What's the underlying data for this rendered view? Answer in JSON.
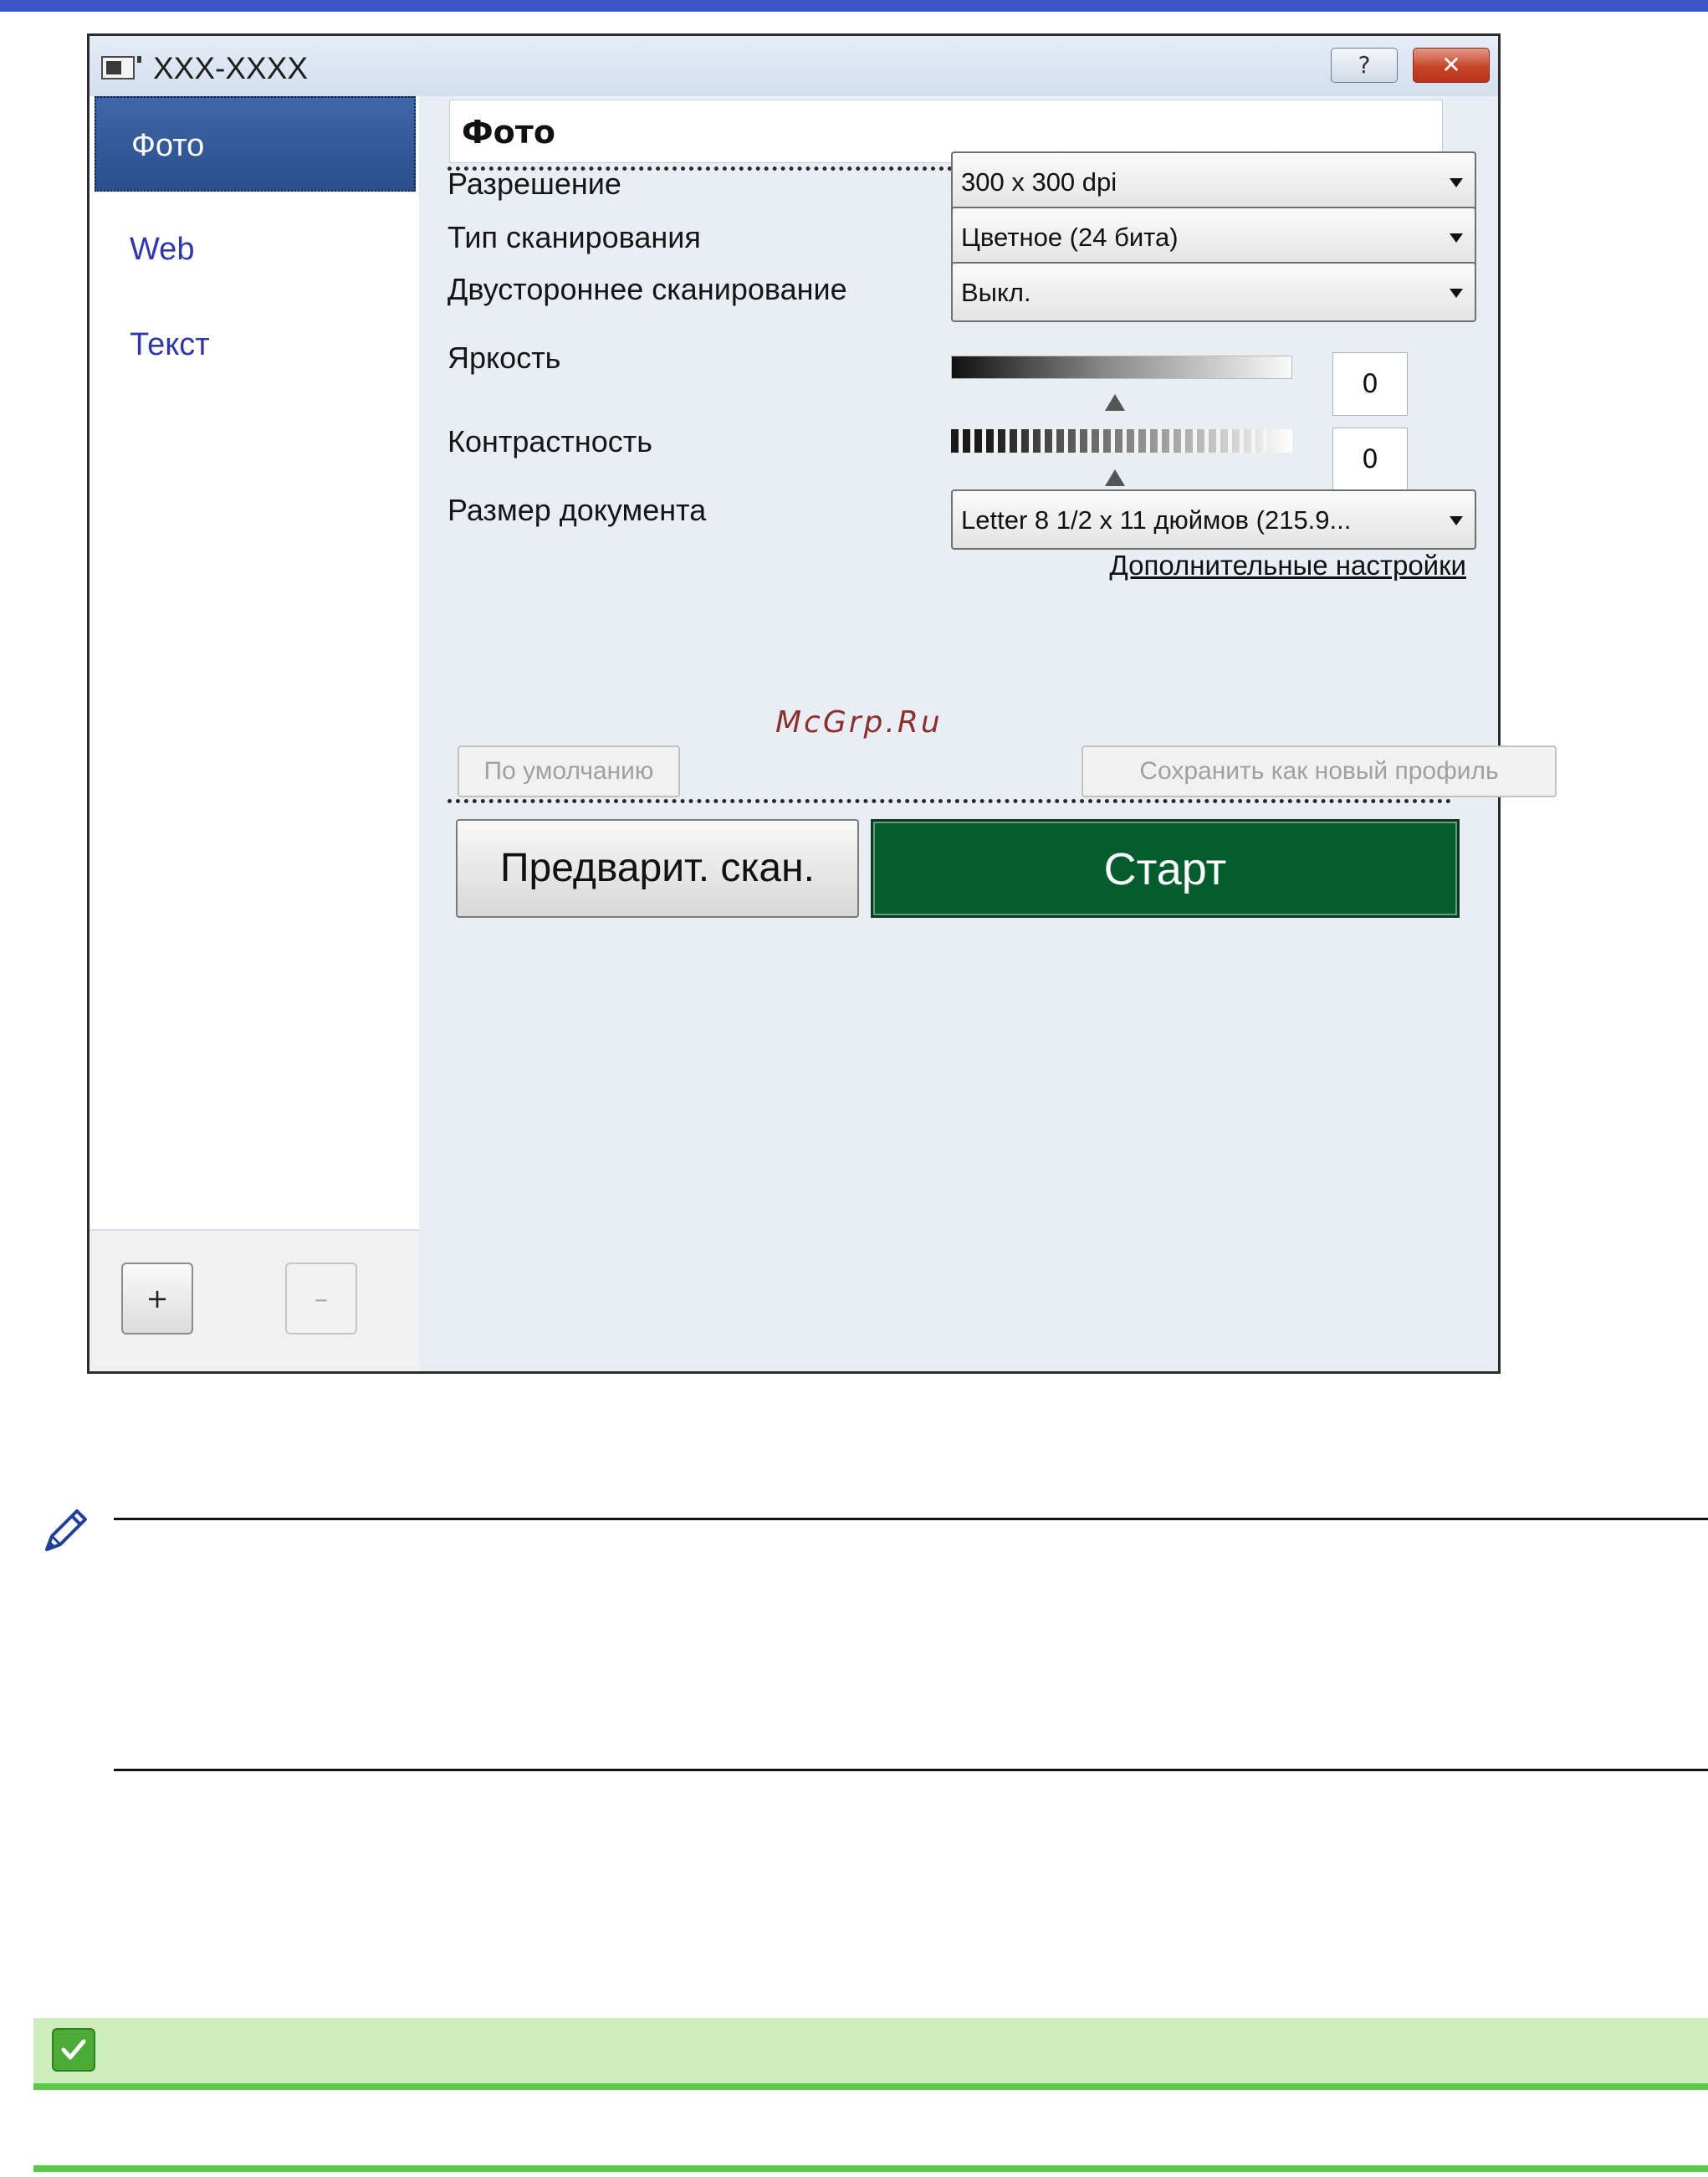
{
  "window": {
    "title": "XXX-XXXX",
    "help_label": "?",
    "close_label": "✕"
  },
  "sidebar": {
    "items": [
      {
        "label": "Фото",
        "selected": true
      },
      {
        "label": "Web",
        "selected": false
      },
      {
        "label": "Текст",
        "selected": false
      }
    ],
    "add_label": "+",
    "remove_label": "–"
  },
  "main": {
    "profile_name": "Фото",
    "resolution": {
      "label": "Разрешение",
      "value": "300 x 300 dpi"
    },
    "scan_type": {
      "label": "Тип сканирования",
      "value": "Цветное (24 бита)"
    },
    "duplex": {
      "label": "Двустороннее сканирование",
      "value": "Выкл."
    },
    "brightness": {
      "label": "Яркость",
      "value": "0"
    },
    "contrast": {
      "label": "Контрастность",
      "value": "0"
    },
    "document_size": {
      "label": "Размер документа",
      "value": "Letter 8 1/2 x 11 дюймов (215.9..."
    },
    "advanced_link": "Дополнительные настройки",
    "watermark": "McGrp.Ru",
    "defaults_label": "По умолчанию",
    "save_profile_label": "Сохранить как новый профиль",
    "preview_label": "Предварит. скан.",
    "start_label": "Старт"
  },
  "colors": {
    "start_button": "#045d2c",
    "selected_item": "#2b4f8c",
    "note_bar": "#cfeebe",
    "note_accent": "#5cc84a",
    "top_bar": "#3d55c4"
  },
  "icons": {
    "note": "pencil-icon",
    "check": "checkmark-icon",
    "app": "scanner-app-icon"
  }
}
